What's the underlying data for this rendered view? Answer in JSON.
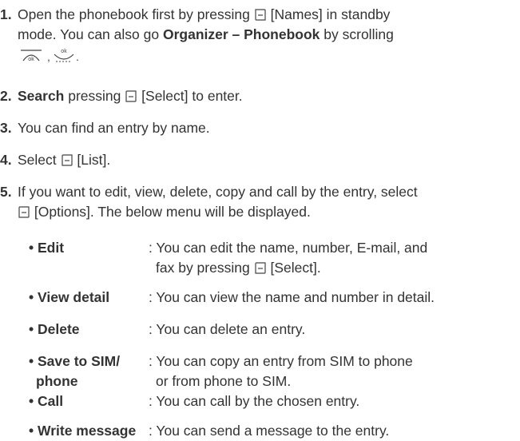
{
  "steps": [
    {
      "num": "1.",
      "a": "Open the phonebook first by pressing",
      "key_label": "[Names] in standby",
      "line2a": "mode. You can also go",
      "bold": "Organizer – Phonebook",
      "line2b": "by scrolling"
    },
    {
      "num": "2.",
      "bold": "Search",
      "a": "pressing",
      "key_label": "[Select] to enter."
    },
    {
      "num": "3.",
      "text": "You can find an entry by name."
    },
    {
      "num": "4.",
      "a": "Select",
      "key_label": "[List]."
    },
    {
      "num": "5.",
      "line1": "If you want to edit, view, delete, copy and call by the entry, select",
      "key_label": "[Options]. The below menu will be displayed."
    }
  ],
  "options": [
    {
      "name": "• Edit",
      "desc1": ": You can edit the name, number, E-mail, and",
      "desc2a": "fax by pressing",
      "desc2b": "[Select]."
    },
    {
      "name": "• View detail",
      "desc": ": You can view the name and number in detail."
    },
    {
      "name": "• Delete",
      "desc": ": You can delete an entry."
    },
    {
      "name1": "• Save to SIM/",
      "name2": "phone",
      "desc1": ": You can copy an entry from SIM to phone",
      "desc2": "or from phone to SIM."
    },
    {
      "name": "• Call",
      "desc": ": You can call by the chosen entry."
    },
    {
      "name": "• Write message",
      "desc": ": You can send a message to the entry."
    }
  ],
  "icons": [
    "right-soft-key-icon",
    "left-soft-key-icon",
    "ok-key-icon",
    "nav-down-key-icon"
  ]
}
